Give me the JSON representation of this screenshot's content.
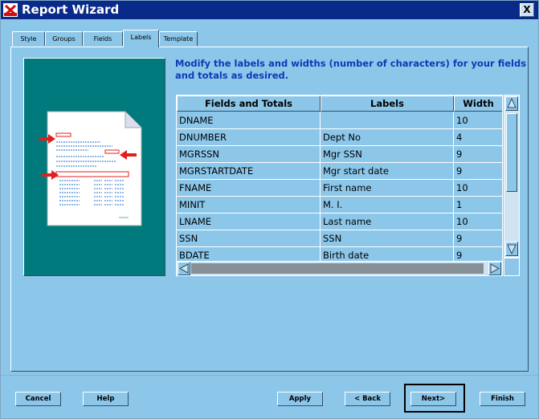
{
  "window": {
    "title": "Report Wizard",
    "close_glyph": "X"
  },
  "tabs": [
    {
      "label": "Style"
    },
    {
      "label": "Groups"
    },
    {
      "label": "Fields"
    },
    {
      "label": "Labels",
      "active": true
    },
    {
      "label": "Template"
    }
  ],
  "instructions": "Modify the labels and widths (number of characters) for your fields and totals as desired.",
  "grid": {
    "columns": [
      "Fields and Totals",
      "Labels",
      "Width"
    ],
    "rows": [
      {
        "field": "DNAME",
        "label": "",
        "width": "10"
      },
      {
        "field": "DNUMBER",
        "label": "Dept No",
        "width": "4"
      },
      {
        "field": "MGRSSN",
        "label": "Mgr SSN",
        "width": "9"
      },
      {
        "field": "MGRSTARTDATE",
        "label": "Mgr start date",
        "width": "9"
      },
      {
        "field": "FNAME",
        "label": "First name",
        "width": "10"
      },
      {
        "field": "MINIT",
        "label": "M. I.",
        "width": "1"
      },
      {
        "field": "LNAME",
        "label": "Last name",
        "width": "10"
      },
      {
        "field": "SSN",
        "label": "SSN",
        "width": "9"
      },
      {
        "field": "BDATE",
        "label": "Birth date",
        "width": "9"
      }
    ]
  },
  "buttons": {
    "cancel": "Cancel",
    "help": "Help",
    "apply": "Apply",
    "back": "< Back",
    "next": "Next>",
    "finish": "Finish"
  },
  "colors": {
    "background": "#8cc7ea",
    "titlebar": "#0a2a8a",
    "illustration_bg": "#007a7c",
    "instruction_text": "#0a3cb4",
    "arrow_red": "#e02020"
  },
  "icons": {
    "app": "x-logo-icon",
    "close": "close-icon"
  }
}
